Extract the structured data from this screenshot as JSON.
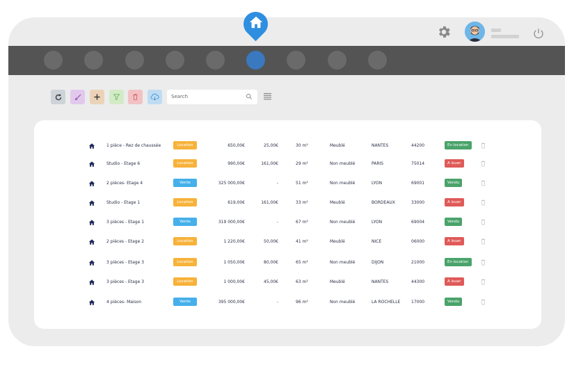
{
  "colors": {
    "accent": "#2e8ee0",
    "navbar": "#545454",
    "nav_active": "#3a78bf",
    "location_badge": "#f7b23a",
    "vente_badge": "#45b0ea",
    "status_green": "#4aa36a",
    "status_red": "#df5a58"
  },
  "header": {
    "home_icon": "home-icon",
    "settings_icon": "gear-icon",
    "user_avatar": "avatar",
    "power_icon": "power-icon"
  },
  "nav": {
    "dot_count": 9,
    "active_index": 5
  },
  "toolbar": {
    "tools": [
      "refresh-icon",
      "brush-icon",
      "plus-icon",
      "filter-icon",
      "trash-icon",
      "download-icon"
    ],
    "search_placeholder": "Search",
    "list_icon": "list-icon"
  },
  "rows": [
    {
      "title": "1 pièce - Rez de chaussée",
      "type": "Location",
      "price": "650,00€",
      "charges": "25,00€",
      "surface": "30 m²",
      "furnished": "Meublé",
      "city": "NANTES",
      "zip": "44200",
      "status": "En location"
    },
    {
      "title": "Studio - Etage 6",
      "type": "Location",
      "price": "990,00€",
      "charges": "161,00€",
      "surface": "29 m²",
      "furnished": "Non meublé",
      "city": "PARIS",
      "zip": "75014",
      "status": "A louer"
    },
    {
      "title": "2 pièces- Etage 4",
      "type": "Vente",
      "price": "325 000,00€",
      "charges": "-",
      "surface": "51 m²",
      "furnished": "Non meublé",
      "city": "LYON",
      "zip": "69001",
      "status": "Vendu"
    },
    {
      "title": "Studio - Etage 1",
      "type": "Location",
      "price": "619,00€",
      "charges": "161,00€",
      "surface": "33 m²",
      "furnished": "Meublé",
      "city": "BORDEAUX",
      "zip": "33000",
      "status": "A louer"
    },
    {
      "title": "3 pièces - Etage 1",
      "type": "Vente",
      "price": "319 000,00€",
      "charges": "-",
      "surface": "67 m²",
      "furnished": "Non meublé",
      "city": "LYON",
      "zip": "69004",
      "status": "Vendu"
    },
    {
      "title": "2 pièces - Etage 2",
      "type": "Location",
      "price": "1 220,00€",
      "charges": "50,00€",
      "surface": "41 m²",
      "furnished": "Meublé",
      "city": "NICE",
      "zip": "06000",
      "status": "A louer"
    },
    {
      "title": "3 pièces - Etage 3",
      "type": "Location",
      "price": "1 050,00€",
      "charges": "80,00€",
      "surface": "65 m²",
      "furnished": "Non meublé",
      "city": "DIJON",
      "zip": "21000",
      "status": "En location"
    },
    {
      "title": "3 pièces - Etage 3",
      "type": "Location",
      "price": "1 000,00€",
      "charges": "45,00€",
      "surface": "63 m²",
      "furnished": "Meublé",
      "city": "NANTES",
      "zip": "44300",
      "status": "A louer"
    },
    {
      "title": "4 pièces- Maison",
      "type": "Vente",
      "price": "395 000,00€",
      "charges": "-",
      "surface": "96 m²",
      "furnished": "Non meublé",
      "city": "LA ROCHELLE",
      "zip": "17000",
      "status": "Vendu"
    }
  ]
}
